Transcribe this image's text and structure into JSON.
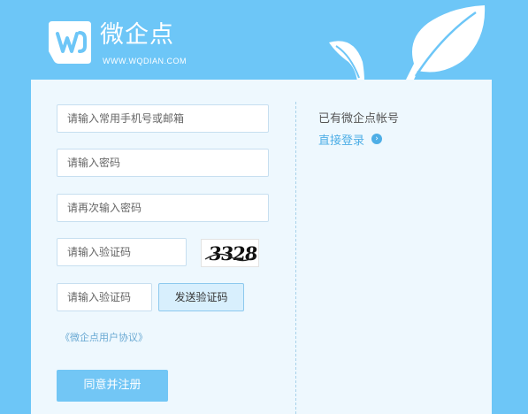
{
  "brand": {
    "name": "微企点",
    "url": "WWW.WQDIAN.COM",
    "logo_icon": "wqdian-logo-icon",
    "decor_icon": "leaf-icon"
  },
  "form": {
    "phone_email_placeholder": "请输入常用手机号或邮箱",
    "password_placeholder": "请输入密码",
    "confirm_password_placeholder": "请再次输入密码",
    "captcha_placeholder": "请输入验证码",
    "captcha_image_text": "3328",
    "sms_code_placeholder": "请输入验证码",
    "send_code_label": "发送验证码",
    "agreement_link": "《微企点用户协议》",
    "register_label": "同意并注册"
  },
  "side": {
    "have_account_text": "已有微企点帐号",
    "login_link": "直接登录",
    "login_arrow_icon": "arrow-circle-icon"
  },
  "colors": {
    "page_bg": "#6dc6f7",
    "card_bg": "#eef8fe",
    "accent": "#4eaee6",
    "button_primary": "#72c6f5"
  }
}
